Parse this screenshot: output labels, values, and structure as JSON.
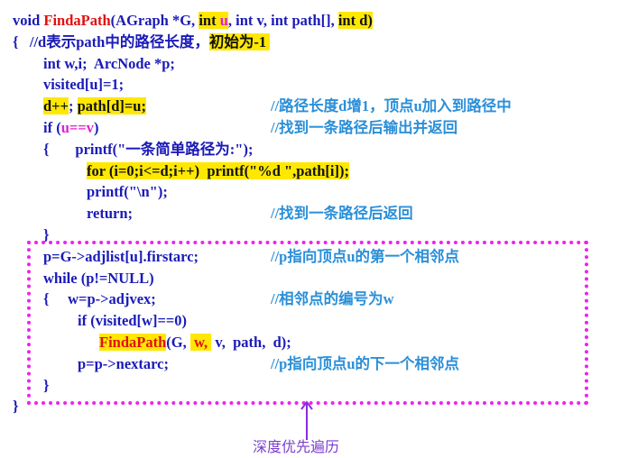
{
  "lines": [
    {
      "code": [
        {
          "t": "void ",
          "s": ""
        },
        {
          "t": "FindaPath",
          "s": "r"
        },
        {
          "t": "(AGraph *G, ",
          "s": ""
        },
        {
          "t": "int ",
          "s": "hl"
        },
        {
          "t": "u",
          "s": "hl m"
        },
        {
          "t": ", int v, int path[], ",
          "s": ""
        },
        {
          "t": "int d)",
          "s": "hl"
        }
      ],
      "comment": ""
    },
    {
      "code": [
        {
          "t": "{   ",
          "s": ""
        },
        {
          "t": "//d表示path中的路径长度，",
          "s": ""
        },
        {
          "t": "初始为-1 ",
          "s": "hl"
        }
      ],
      "comment": ""
    },
    {
      "code": [
        {
          "t": "int w,i;  ArcNode *p;",
          "s": ""
        }
      ],
      "comment": ""
    },
    {
      "code": [
        {
          "t": "visited[u]=1;",
          "s": ""
        }
      ],
      "comment": ""
    },
    {
      "code": [
        {
          "t": "d++",
          "s": "hl"
        },
        {
          "t": "; ",
          "s": ""
        },
        {
          "t": "path[d]=u;",
          "s": "hl"
        }
      ],
      "comment": "//路径长度d增1，顶点u加入到路径中"
    },
    {
      "code": [
        {
          "t": "if (",
          "s": ""
        },
        {
          "t": "u==v",
          "s": "m"
        },
        {
          "t": ")",
          "s": ""
        }
      ],
      "comment": "//找到一条路径后输出并返回"
    },
    {
      "code": [
        {
          "t": "{       ",
          "s": ""
        },
        {
          "t": "printf(\"一条简单路径为:\");",
          "s": ""
        }
      ],
      "comment": ""
    },
    {
      "code": [
        {
          "t": "for (i=0;i<=d;i++)  printf(\"%d \",path[i]);",
          "s": "hl"
        }
      ],
      "comment": ""
    },
    {
      "code": [
        {
          "t": "printf(\"\\n\");",
          "s": ""
        }
      ],
      "comment": ""
    },
    {
      "code": [
        {
          "t": "return;",
          "s": ""
        }
      ],
      "comment": "//找到一条路径后返回"
    },
    {
      "code": [
        {
          "t": "}",
          "s": ""
        }
      ],
      "comment": ""
    },
    {
      "code": [
        {
          "t": "p=G->adjlist[u].firstarc;",
          "s": ""
        }
      ],
      "comment": "//p指向顶点u的第一个相邻点"
    },
    {
      "code": [
        {
          "t": "while (p!=NULL)",
          "s": ""
        }
      ],
      "comment": ""
    },
    {
      "code": [
        {
          "t": "{     w=p->adjvex;",
          "s": ""
        }
      ],
      "comment": "//相邻点的编号为w"
    },
    {
      "code": [
        {
          "t": "if (visited[w]==0)",
          "s": ""
        }
      ],
      "comment": ""
    },
    {
      "code": [
        {
          "t": "FindaPath",
          "s": "hl r"
        },
        {
          "t": "(G, ",
          "s": ""
        },
        {
          "t": " w, ",
          "s": "hl r"
        },
        {
          "t": " v,  path,  d);",
          "s": ""
        }
      ],
      "comment": ""
    },
    {
      "code": [
        {
          "t": "p=p->nextarc;",
          "s": ""
        }
      ],
      "comment": "//p指向顶点u的下一个相邻点"
    },
    {
      "code": [
        {
          "t": "}",
          "s": ""
        }
      ],
      "comment": ""
    },
    {
      "code": [
        {
          "t": "}",
          "s": ""
        }
      ],
      "comment": ""
    }
  ],
  "annotation": {
    "label": "深度优先遍历"
  },
  "colors": {
    "code": "#1a1ab8",
    "comment": "#2b8fd8",
    "highlight": "#ffe800",
    "box": "#ee22ee",
    "keyword_red": "#e01010"
  }
}
